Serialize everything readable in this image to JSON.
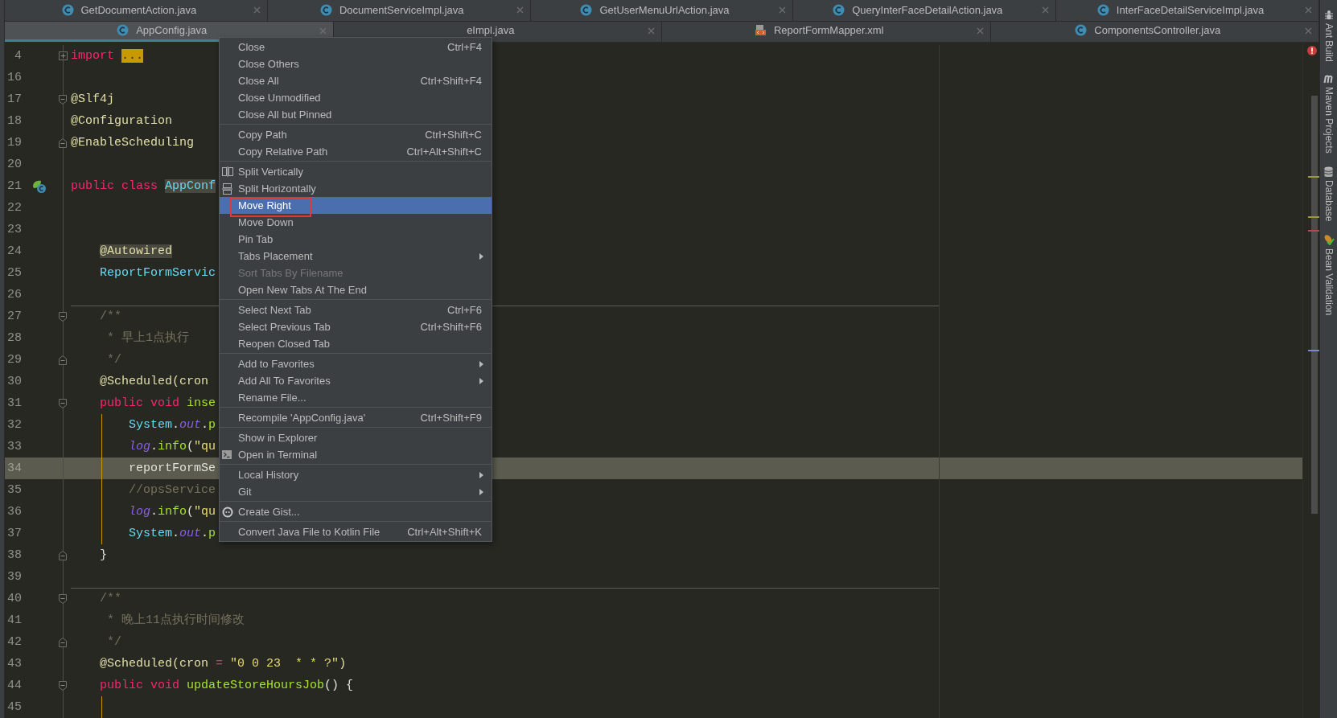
{
  "tab_rows": [
    {
      "tabs": [
        {
          "label": "GetDocumentAction.java",
          "kind": "java",
          "selected": false
        },
        {
          "label": "DocumentServiceImpl.java",
          "kind": "java",
          "selected": false
        },
        {
          "label": "GetUserMenuUrlAction.java",
          "kind": "java",
          "selected": false
        },
        {
          "label": "QueryInterFaceDetailAction.java",
          "kind": "java",
          "selected": false
        },
        {
          "label": "InterFaceDetailServiceImpl.java",
          "kind": "java",
          "selected": false
        }
      ]
    },
    {
      "tabs": [
        {
          "label": "AppConfig.java",
          "kind": "java",
          "selected": true
        },
        {
          "label": "eImpl.java",
          "kind": "covered",
          "selected": false
        },
        {
          "label": "ReportFormMapper.xml",
          "kind": "xml",
          "selected": false
        },
        {
          "label": "ComponentsController.java",
          "kind": "java",
          "selected": false
        }
      ]
    }
  ],
  "editor": {
    "lines": [
      {
        "number": "4",
        "kind": "fold-collapsed",
        "current": false,
        "guide": false,
        "separator": false,
        "tokens": [
          {
            "kind": "keyword",
            "text": "import "
          },
          {
            "kind": "folded",
            "text": "..."
          }
        ]
      },
      {
        "number": "16",
        "kind": "plain",
        "current": false,
        "guide": false,
        "separator": false
      },
      {
        "number": "17",
        "kind": "fold-start",
        "current": false,
        "guide": false,
        "separator": false,
        "tokens": [
          {
            "kind": "annotation",
            "text": "@Slf4j"
          }
        ]
      },
      {
        "number": "18",
        "kind": "plain",
        "current": false,
        "guide": false,
        "separator": false,
        "tokens": [
          {
            "kind": "annotation",
            "text": "@Configuration"
          }
        ]
      },
      {
        "number": "19",
        "kind": "fold-end",
        "current": false,
        "guide": false,
        "separator": false,
        "tokens": [
          {
            "kind": "annotation",
            "text": "@EnableScheduling"
          }
        ]
      },
      {
        "number": "20",
        "kind": "plain",
        "current": false,
        "guide": false,
        "separator": false
      },
      {
        "number": "21",
        "kind": "bean-class",
        "current": false,
        "guide": false,
        "separator": false,
        "tokens": [
          {
            "kind": "keyword",
            "text": "public class "
          },
          {
            "kind": "type-hl",
            "text": "AppConf"
          }
        ]
      },
      {
        "number": "22",
        "kind": "plain",
        "current": false,
        "guide": false,
        "separator": false
      },
      {
        "number": "23",
        "kind": "plain",
        "current": false,
        "guide": false,
        "separator": false
      },
      {
        "number": "24",
        "kind": "plain",
        "current": false,
        "guide": false,
        "separator": false,
        "tokens": [
          {
            "kind": "annotation-hl",
            "text": "    @Autowired"
          }
        ]
      },
      {
        "number": "25",
        "kind": "plain",
        "current": false,
        "guide": false,
        "separator": false,
        "tokens": [
          {
            "kind": "type",
            "text": "    ReportFormServic"
          }
        ]
      },
      {
        "number": "26",
        "kind": "plain",
        "current": false,
        "guide": false,
        "separator": false
      },
      {
        "number": "27",
        "kind": "fold-start",
        "current": false,
        "guide": false,
        "separator": true,
        "tokens": [
          {
            "kind": "comment",
            "text": "    /**"
          }
        ]
      },
      {
        "number": "28",
        "kind": "plain",
        "current": false,
        "guide": false,
        "separator": false,
        "tokens": [
          {
            "kind": "comment",
            "text": "     * 早上1点执行"
          }
        ]
      },
      {
        "number": "29",
        "kind": "fold-end",
        "current": false,
        "guide": false,
        "separator": false,
        "tokens": [
          {
            "kind": "comment",
            "text": "     */"
          }
        ]
      },
      {
        "number": "30",
        "kind": "plain",
        "current": false,
        "guide": false,
        "separator": false,
        "tokens": [
          {
            "kind": "annotation",
            "text": "    @Scheduled(cron"
          }
        ]
      },
      {
        "number": "31",
        "kind": "fold-start",
        "current": false,
        "guide": false,
        "separator": false,
        "tokens": [
          {
            "kind": "keyword",
            "text": "    public void "
          },
          {
            "kind": "method",
            "text": "inse"
          }
        ]
      },
      {
        "number": "32",
        "kind": "plain",
        "current": false,
        "guide": true,
        "separator": false,
        "tokens": [
          {
            "kind": "type",
            "text": "        System"
          },
          {
            "kind": "plain",
            "text": "."
          },
          {
            "kind": "field",
            "text": "out"
          },
          {
            "kind": "plain",
            "text": "."
          },
          {
            "kind": "method",
            "text": "p"
          }
        ]
      },
      {
        "number": "33",
        "kind": "plain",
        "current": false,
        "guide": true,
        "separator": false,
        "tokens": [
          {
            "kind": "field",
            "text": "        log"
          },
          {
            "kind": "plain",
            "text": "."
          },
          {
            "kind": "method",
            "text": "info"
          },
          {
            "kind": "plain",
            "text": "("
          },
          {
            "kind": "string",
            "text": "\"qu"
          }
        ]
      },
      {
        "number": "34",
        "kind": "plain",
        "current": true,
        "guide": true,
        "separator": false,
        "tokens": [
          {
            "kind": "plain",
            "text": "        reportFormSe"
          }
        ]
      },
      {
        "number": "35",
        "kind": "plain",
        "current": false,
        "guide": true,
        "separator": false,
        "tokens": [
          {
            "kind": "comment",
            "text": "        //opsService"
          }
        ]
      },
      {
        "number": "36",
        "kind": "plain",
        "current": false,
        "guide": true,
        "separator": false,
        "tokens": [
          {
            "kind": "field",
            "text": "        log"
          },
          {
            "kind": "plain",
            "text": "."
          },
          {
            "kind": "method",
            "text": "info"
          },
          {
            "kind": "plain",
            "text": "("
          },
          {
            "kind": "string",
            "text": "\"qu"
          }
        ]
      },
      {
        "number": "37",
        "kind": "plain",
        "current": false,
        "guide": true,
        "separator": false,
        "tokens": [
          {
            "kind": "type",
            "text": "        System"
          },
          {
            "kind": "plain",
            "text": "."
          },
          {
            "kind": "field",
            "text": "out"
          },
          {
            "kind": "plain",
            "text": "."
          },
          {
            "kind": "method",
            "text": "p"
          }
        ]
      },
      {
        "number": "38",
        "kind": "fold-end",
        "current": false,
        "guide": false,
        "separator": false,
        "tokens": [
          {
            "kind": "plain",
            "text": "    }"
          }
        ]
      },
      {
        "number": "39",
        "kind": "plain",
        "current": false,
        "guide": false,
        "separator": false
      },
      {
        "number": "40",
        "kind": "fold-start",
        "current": false,
        "guide": false,
        "separator": true,
        "tokens": [
          {
            "kind": "comment",
            "text": "    /**"
          }
        ]
      },
      {
        "number": "41",
        "kind": "plain",
        "current": false,
        "guide": false,
        "separator": false,
        "tokens": [
          {
            "kind": "comment",
            "text": "     * 晚上11点执行时间修改"
          }
        ]
      },
      {
        "number": "42",
        "kind": "fold-end",
        "current": false,
        "guide": false,
        "separator": false,
        "tokens": [
          {
            "kind": "comment",
            "text": "     */"
          }
        ]
      },
      {
        "number": "43",
        "kind": "plain",
        "current": false,
        "guide": false,
        "separator": false,
        "tokens": [
          {
            "kind": "annotation",
            "text": "    @Scheduled(cron "
          },
          {
            "kind": "operator",
            "text": "= "
          },
          {
            "kind": "string",
            "text": "\"0 0 23  * * ?\""
          },
          {
            "kind": "annotation",
            "text": ")"
          }
        ]
      },
      {
        "number": "44",
        "kind": "fold-start",
        "current": false,
        "guide": false,
        "separator": false,
        "tokens": [
          {
            "kind": "keyword",
            "text": "    public void "
          },
          {
            "kind": "method",
            "text": "updateStoreHoursJob"
          },
          {
            "kind": "plain",
            "text": "() {"
          }
        ]
      },
      {
        "number": "45",
        "kind": "plain",
        "current": false,
        "guide": true,
        "separator": false
      }
    ]
  },
  "menu": {
    "groups": [
      {
        "items": [
          {
            "label": "Close",
            "shortcut": "Ctrl+F4",
            "kind": "plain",
            "selected": false,
            "disabled": false,
            "submenu": false
          },
          {
            "label": "Close Others",
            "kind": "plain",
            "selected": false,
            "disabled": false,
            "submenu": false
          },
          {
            "label": "Close All",
            "shortcut": "Ctrl+Shift+F4",
            "kind": "plain",
            "selected": false,
            "disabled": false,
            "submenu": false
          },
          {
            "label": "Close Unmodified",
            "kind": "plain",
            "selected": false,
            "disabled": false,
            "submenu": false
          },
          {
            "label": "Close All but Pinned",
            "kind": "plain",
            "selected": false,
            "disabled": false,
            "submenu": false
          }
        ]
      },
      {
        "items": [
          {
            "label": "Copy Path",
            "shortcut": "Ctrl+Shift+C",
            "kind": "plain",
            "selected": false,
            "disabled": false,
            "submenu": false
          },
          {
            "label": "Copy Relative Path",
            "shortcut": "Ctrl+Alt+Shift+C",
            "kind": "plain",
            "selected": false,
            "disabled": false,
            "submenu": false
          }
        ]
      },
      {
        "items": [
          {
            "label": "Split Vertically",
            "kind": "split-vertical",
            "selected": false,
            "disabled": false,
            "submenu": false
          },
          {
            "label": "Split Horizontally",
            "kind": "split-horizontal",
            "selected": false,
            "disabled": false,
            "submenu": false
          },
          {
            "label": "Move Right",
            "kind": "plain",
            "selected": true,
            "disabled": false,
            "submenu": false
          },
          {
            "label": "Move Down",
            "kind": "plain",
            "selected": false,
            "disabled": false,
            "submenu": false
          },
          {
            "label": "Pin Tab",
            "kind": "plain",
            "selected": false,
            "disabled": false,
            "submenu": false
          },
          {
            "label": "Tabs Placement",
            "kind": "plain",
            "selected": false,
            "disabled": false,
            "submenu": true
          },
          {
            "label": "Sort Tabs By Filename",
            "kind": "plain",
            "selected": false,
            "disabled": true,
            "submenu": false
          },
          {
            "label": "Open New Tabs At The End",
            "kind": "plain",
            "selected": false,
            "disabled": false,
            "submenu": false
          }
        ]
      },
      {
        "items": [
          {
            "label": "Select Next Tab",
            "shortcut": "Ctrl+F6",
            "kind": "plain",
            "selected": false,
            "disabled": false,
            "submenu": false
          },
          {
            "label": "Select Previous Tab",
            "shortcut": "Ctrl+Shift+F6",
            "kind": "plain",
            "selected": false,
            "disabled": false,
            "submenu": false
          },
          {
            "label": "Reopen Closed Tab",
            "kind": "plain",
            "selected": false,
            "disabled": false,
            "submenu": false
          }
        ]
      },
      {
        "items": [
          {
            "label": "Add to Favorites",
            "kind": "plain",
            "selected": false,
            "disabled": false,
            "submenu": true
          },
          {
            "label": "Add All To Favorites",
            "kind": "plain",
            "selected": false,
            "disabled": false,
            "submenu": true
          },
          {
            "label": "Rename File...",
            "kind": "plain",
            "selected": false,
            "disabled": false,
            "submenu": false
          }
        ]
      },
      {
        "items": [
          {
            "label": "Recompile 'AppConfig.java'",
            "shortcut": "Ctrl+Shift+F9",
            "kind": "plain",
            "selected": false,
            "disabled": false,
            "submenu": false
          }
        ]
      },
      {
        "items": [
          {
            "label": "Show in Explorer",
            "kind": "plain",
            "selected": false,
            "disabled": false,
            "submenu": false
          },
          {
            "label": "Open in Terminal",
            "kind": "terminal",
            "selected": false,
            "disabled": false,
            "submenu": false
          }
        ]
      },
      {
        "items": [
          {
            "label": "Local History",
            "kind": "plain",
            "selected": false,
            "disabled": false,
            "submenu": true
          },
          {
            "label": "Git",
            "kind": "plain",
            "selected": false,
            "disabled": false,
            "submenu": true
          }
        ]
      },
      {
        "items": [
          {
            "label": "Create Gist...",
            "kind": "gist",
            "selected": false,
            "disabled": false,
            "submenu": false
          }
        ]
      },
      {
        "items": [
          {
            "label": "Convert Java File to Kotlin File",
            "shortcut": "Ctrl+Alt+Shift+K",
            "kind": "plain",
            "selected": false,
            "disabled": false,
            "submenu": false
          }
        ]
      }
    ]
  },
  "annotations": [
    {
      "kind": "frame"
    }
  ],
  "tool_windows": [
    {
      "label": "Ant Build",
      "kind": "ant"
    },
    {
      "label": "Maven Projects",
      "kind": "maven"
    },
    {
      "label": "Database",
      "kind": "database"
    },
    {
      "label": "Bean Validation",
      "kind": "bean"
    }
  ]
}
